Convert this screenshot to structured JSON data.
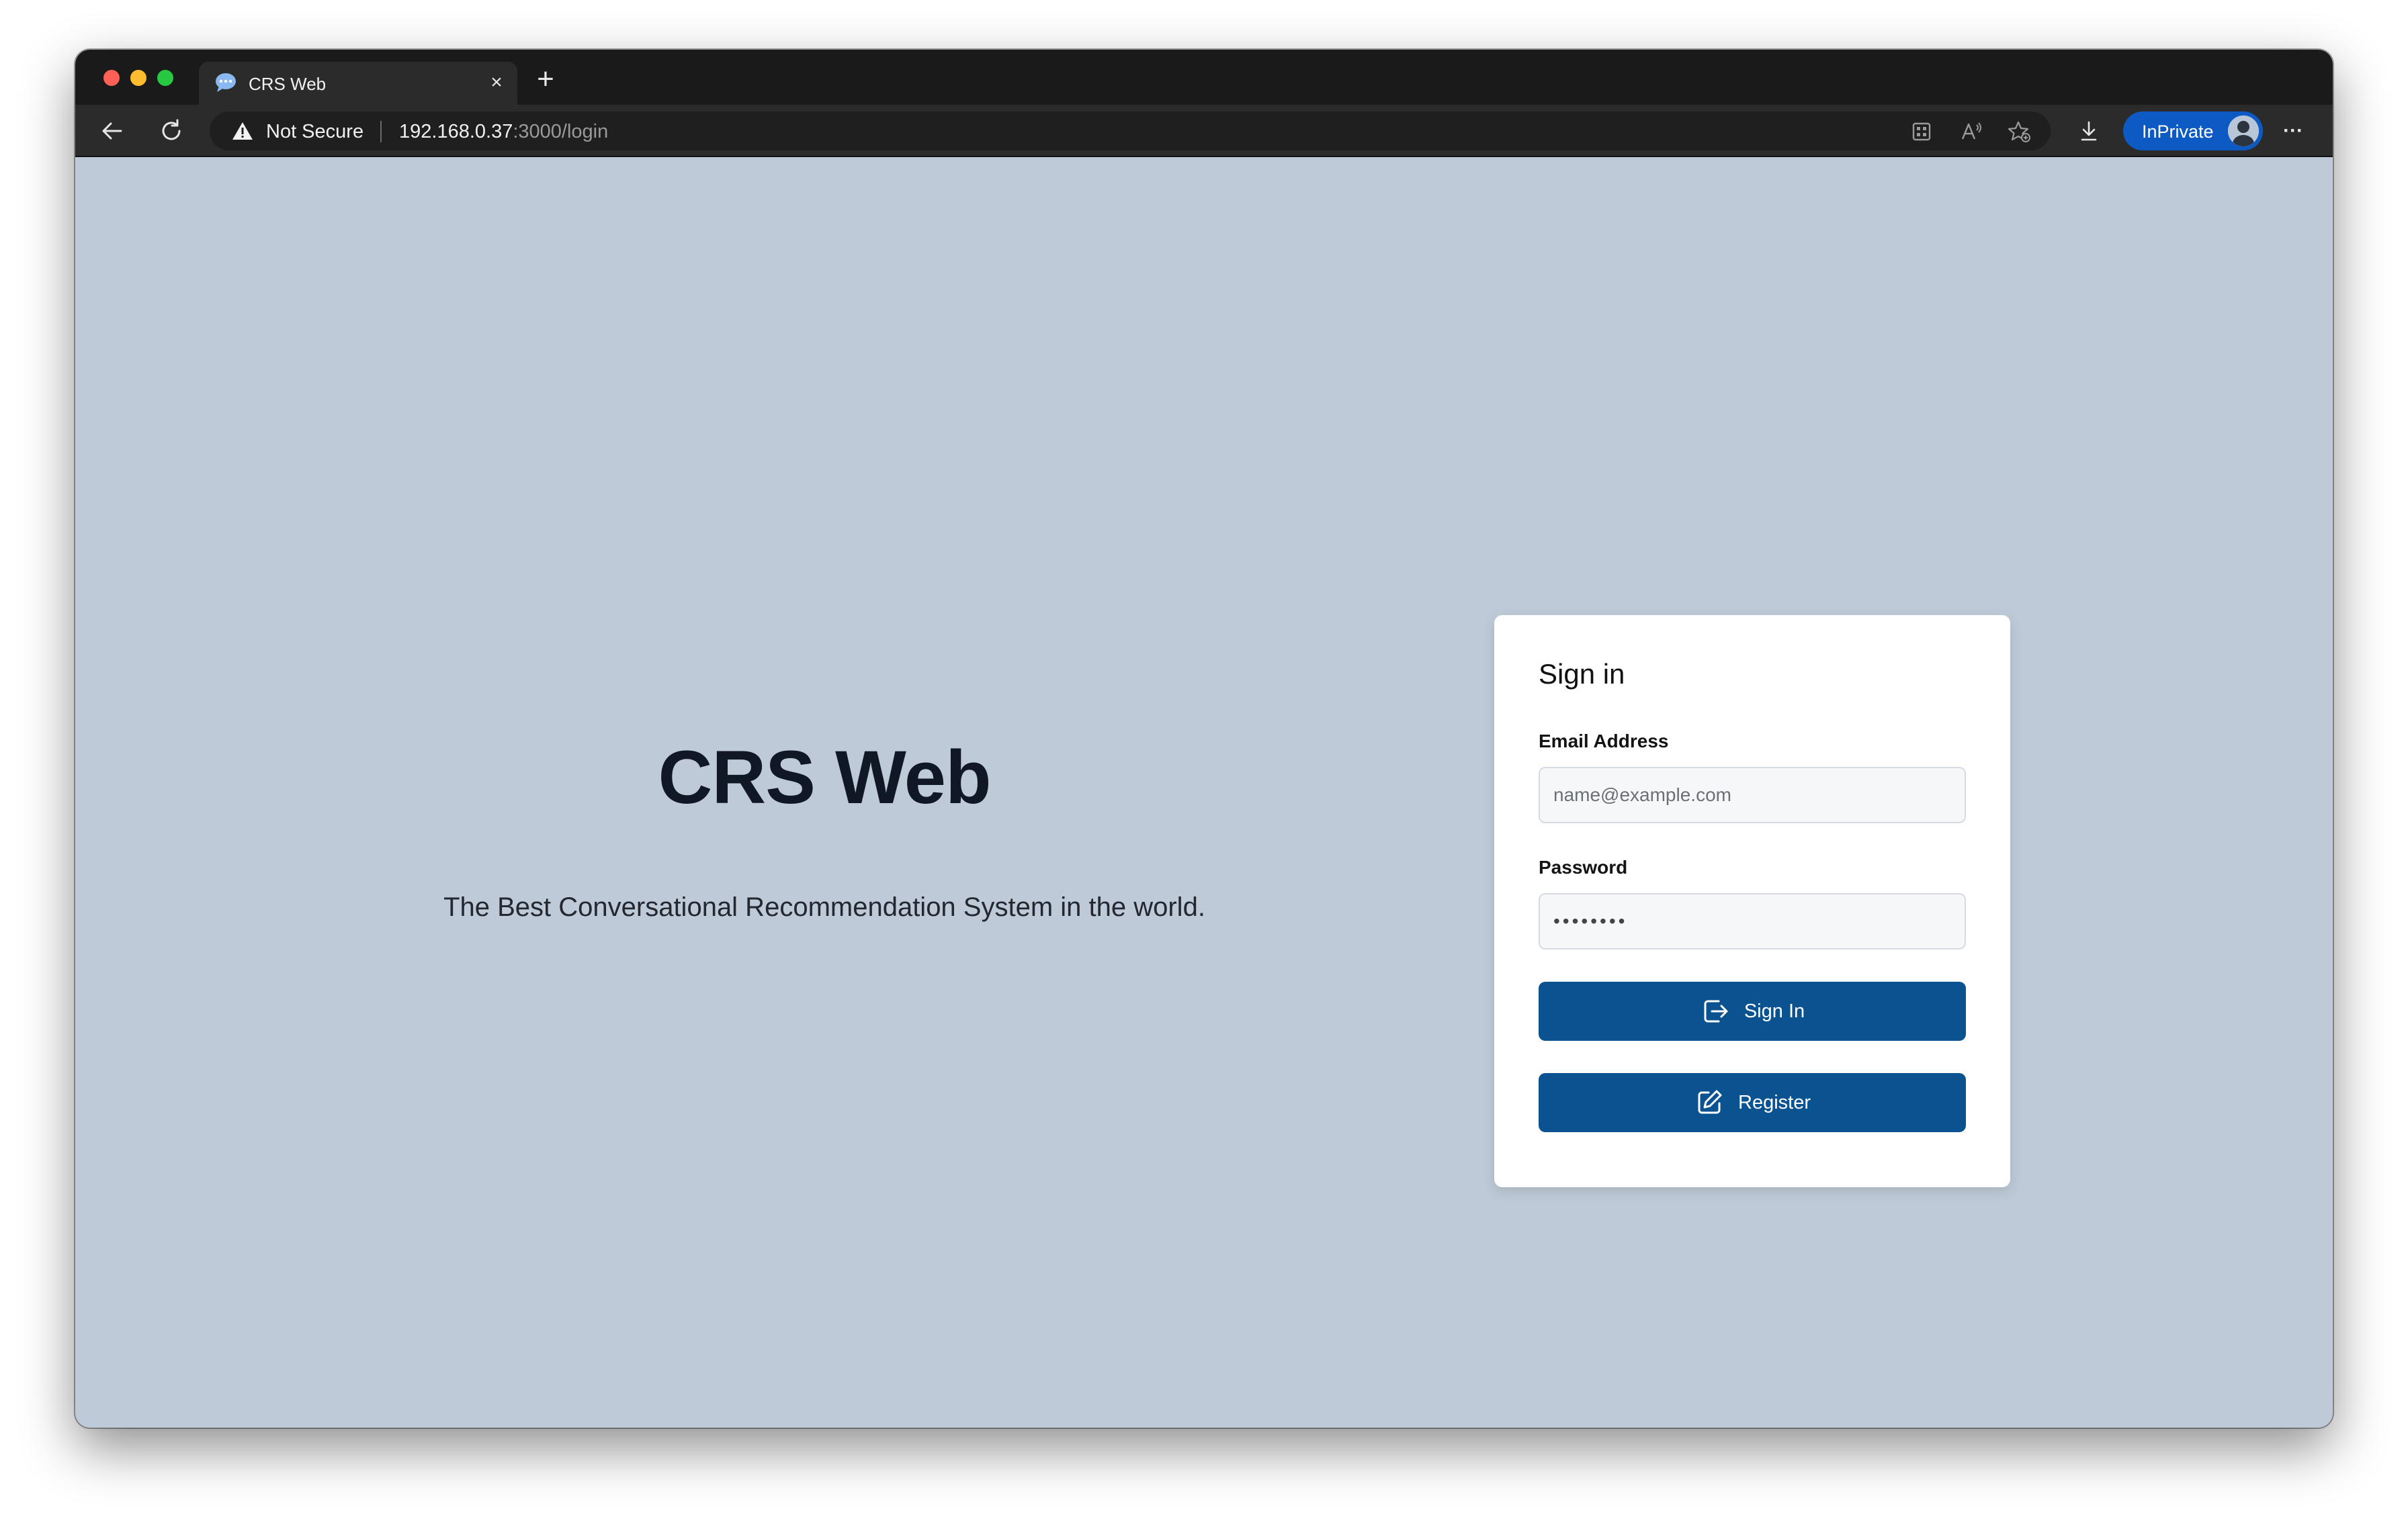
{
  "browser": {
    "tab_title": "CRS Web",
    "tab_close_glyph": "×",
    "new_tab_glyph": "+",
    "security_label": "Not Secure",
    "url_host": "192.168.0.37",
    "url_rest": ":3000/login",
    "profile_label": "InPrivate",
    "more_glyph": "···",
    "icons": [
      "back-arrow-icon",
      "reload-icon",
      "warning-icon",
      "apps-icon",
      "read-aloud-icon",
      "add-favorite-icon",
      "download-icon",
      "profile-avatar-icon",
      "more-icon"
    ],
    "colors": {
      "tabstrip": "#1a1a1a",
      "toolbar": "#2b2b2b",
      "inprivate": "#0e5ac4"
    }
  },
  "hero": {
    "title": "CRS Web",
    "tagline": "The Best Conversational Recommendation System in the world."
  },
  "signin": {
    "heading": "Sign in",
    "email_label": "Email Address",
    "email_placeholder": "name@example.com",
    "email_value": "",
    "password_label": "Password",
    "password_value": "••••••••",
    "signin_button": "Sign In",
    "register_button": "Register",
    "icons": {
      "signin": "login-icon",
      "register": "edit-icon"
    }
  },
  "colors": {
    "page_background": "#bfcad8",
    "button": "#0b5390",
    "title_text": "#101725"
  }
}
